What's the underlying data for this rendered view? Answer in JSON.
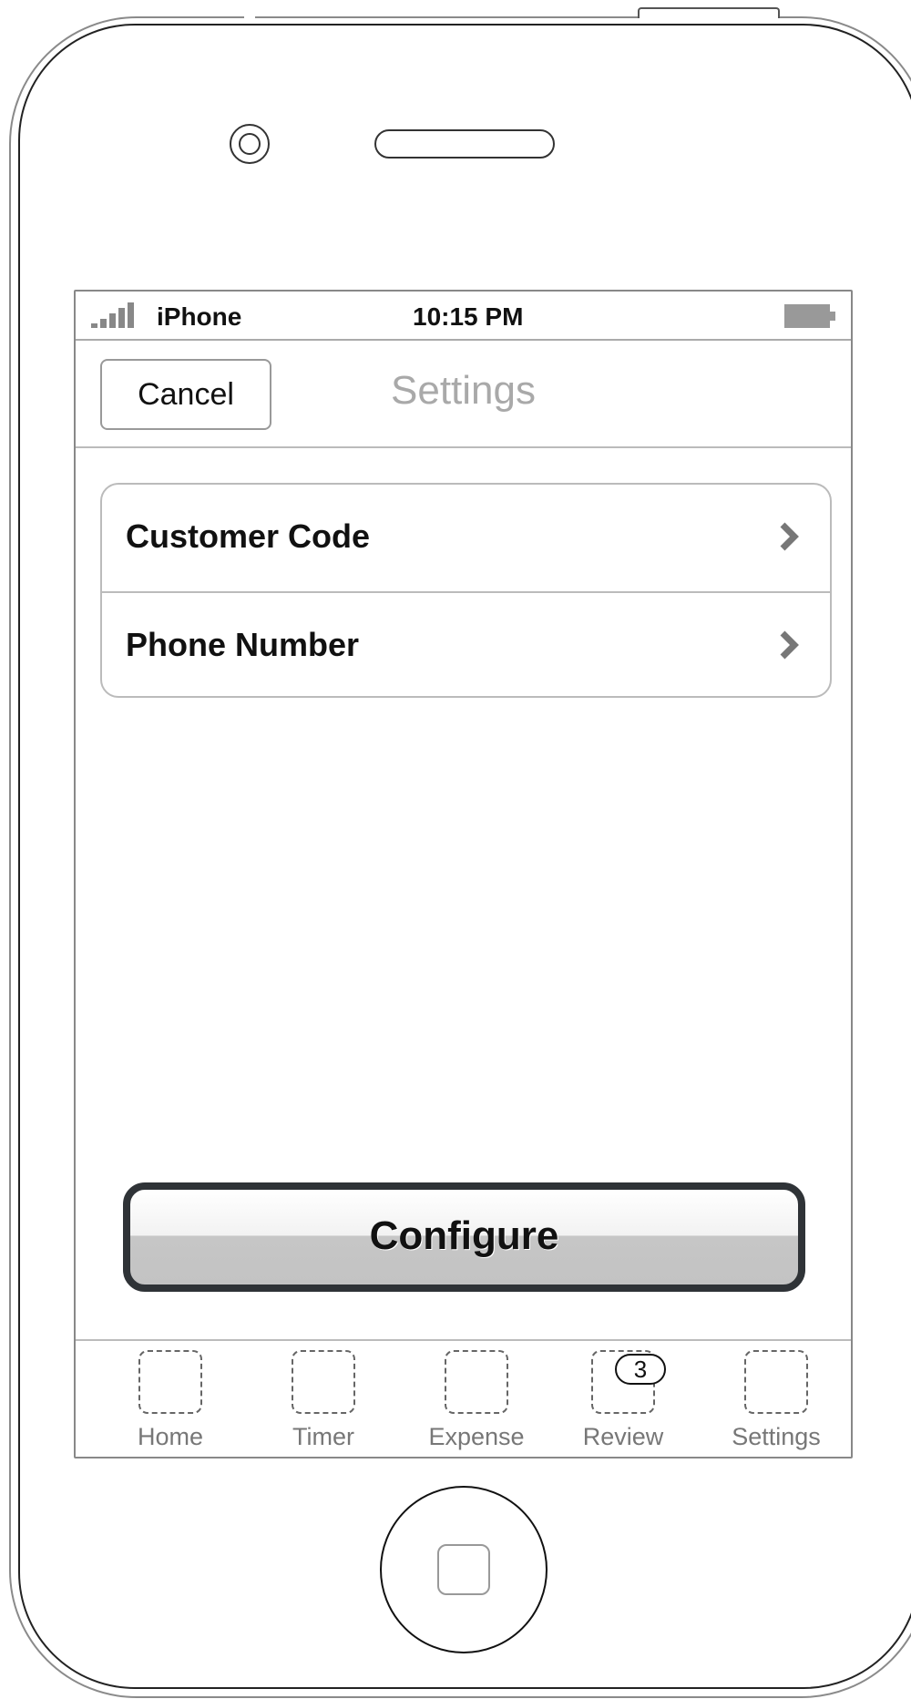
{
  "status_bar": {
    "carrier": "iPhone",
    "time": "10:15 PM"
  },
  "nav": {
    "cancel_label": "Cancel",
    "title": "Settings"
  },
  "settings_list": [
    {
      "label": "Customer Code"
    },
    {
      "label": "Phone Number"
    }
  ],
  "configure_label": "Configure",
  "tab_bar": {
    "tabs": [
      {
        "label": "Home"
      },
      {
        "label": "Timer"
      },
      {
        "label": "Expense"
      },
      {
        "label": "Review",
        "badge": "3"
      },
      {
        "label": "Settings"
      }
    ]
  },
  "icons": {
    "signal": "signal-strength-icon",
    "battery": "battery-icon",
    "chevron": "chevron-right-icon",
    "tab_placeholder": "tab-placeholder-icon"
  }
}
